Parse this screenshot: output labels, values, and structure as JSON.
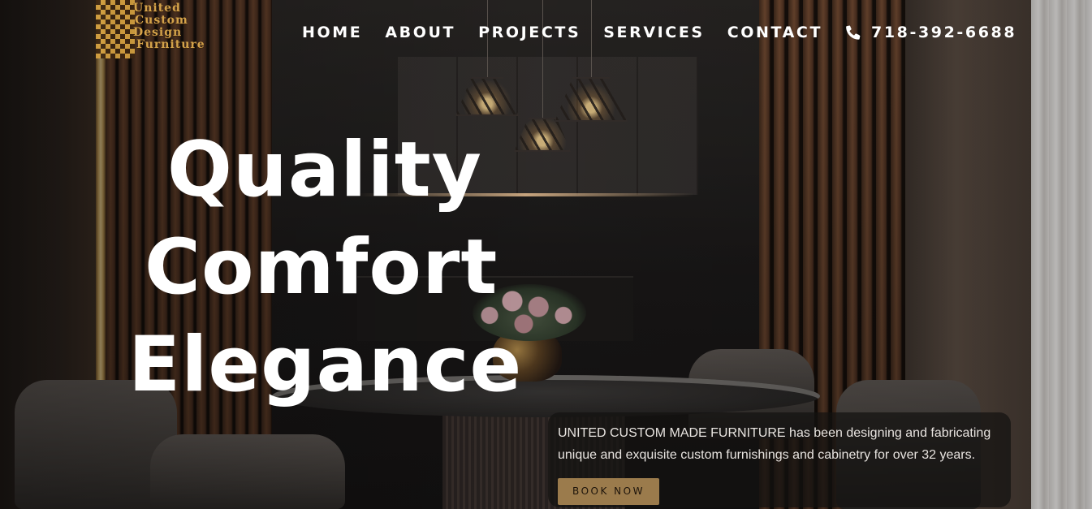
{
  "brand": {
    "logo_lines": [
      "United",
      "Custom",
      "Design",
      "Furniture"
    ],
    "logo_color": "#d3a24a"
  },
  "nav": {
    "items": [
      {
        "label": "HOME"
      },
      {
        "label": "ABOUT"
      },
      {
        "label": "PROJECTS"
      },
      {
        "label": "SERVICES"
      },
      {
        "label": "CONTACT"
      }
    ],
    "phone": {
      "icon": "phone-icon",
      "number": "718-392-6688"
    }
  },
  "hero": {
    "lines": [
      "Quality",
      "Comfort",
      "Elegance"
    ],
    "description": "UNITED CUSTOM MADE FURNITURE has been designing and fabricating unique and exquisite custom furnishings and cabinetry for over 32 years.",
    "cta_label": "BOOK NOW",
    "cta_color": "#9b7b4c"
  }
}
